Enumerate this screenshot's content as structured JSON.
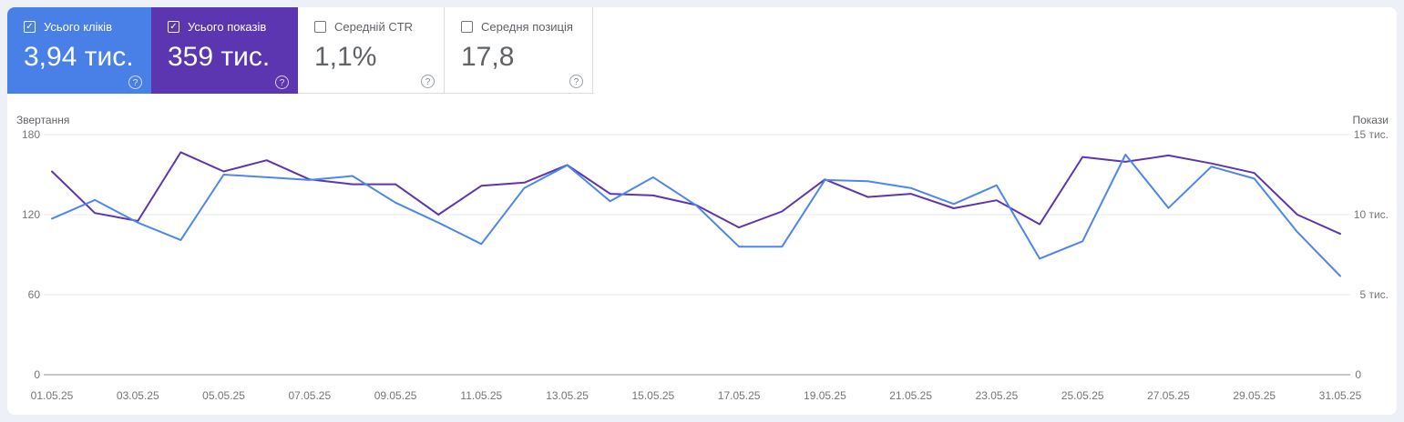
{
  "cards": [
    {
      "label": "Усього кліків",
      "value": "3,94 тис.",
      "checked": true,
      "bg": "#4880e8"
    },
    {
      "label": "Усього показів",
      "value": "359 тис.",
      "checked": true,
      "bg": "#5c35b0"
    },
    {
      "label": "Середній CTR",
      "value": "1,1%",
      "checked": false,
      "bg": "#ffffff"
    },
    {
      "label": "Середня позиція",
      "value": "17,8",
      "checked": false,
      "bg": "#ffffff"
    }
  ],
  "help_icon_glyph": "?",
  "checkmark_glyph": "✓",
  "colors": {
    "clicks_line": "#4e86ec",
    "impressions_line": "#5e35b1",
    "grid": "#e6e8eb",
    "baseline": "#8a9097",
    "axis_text": "#757575",
    "axis_title_text": "#5f6368",
    "page_bg": "#edf0f6",
    "card_border": "#dadce0"
  },
  "chart_data": {
    "type": "line",
    "title": "",
    "left_axis": {
      "title": "Звертання",
      "ticks": [
        0,
        60,
        120,
        180
      ],
      "range": [
        0,
        180
      ]
    },
    "right_axis": {
      "title": "Покази",
      "tick_labels": [
        "0",
        "5 тис.",
        "10 тис.",
        "15 тис."
      ],
      "range_thousands": [
        0,
        15
      ]
    },
    "x_tick_labels": [
      "01.05.25",
      "03.05.25",
      "05.05.25",
      "07.05.25",
      "09.05.25",
      "11.05.25",
      "13.05.25",
      "15.05.25",
      "17.05.25",
      "19.05.25",
      "21.05.25",
      "23.05.25",
      "25.05.25",
      "27.05.25",
      "29.05.25",
      "31.05.25"
    ],
    "dates": [
      "01.05.25",
      "02.05.25",
      "03.05.25",
      "04.05.25",
      "05.05.25",
      "06.05.25",
      "07.05.25",
      "08.05.25",
      "09.05.25",
      "10.05.25",
      "11.05.25",
      "12.05.25",
      "13.05.25",
      "14.05.25",
      "15.05.25",
      "16.05.25",
      "17.05.25",
      "18.05.25",
      "19.05.25",
      "20.05.25",
      "21.05.25",
      "22.05.25",
      "23.05.25",
      "24.05.25",
      "25.05.25",
      "26.05.25",
      "27.05.25",
      "28.05.25",
      "29.05.25",
      "30.05.25",
      "31.05.25"
    ],
    "grid": "horizontal",
    "legend_position": "none",
    "series": [
      {
        "name": "Усього кліків",
        "axis": "left",
        "color": "#4e86ec",
        "values": [
          117,
          131,
          114,
          101,
          150,
          148,
          146,
          149,
          129,
          114,
          98,
          140,
          157,
          130,
          148,
          127,
          96,
          96,
          146,
          145,
          140,
          128,
          142,
          87,
          100,
          165,
          125,
          156,
          147,
          107,
          74
        ]
      },
      {
        "name": "Усього показів",
        "axis": "right",
        "unit": "тис.",
        "color": "#5e35b1",
        "values_thousands": [
          12.7,
          10.1,
          9.6,
          13.9,
          12.7,
          13.4,
          12.2,
          11.9,
          11.9,
          10.0,
          11.8,
          12.0,
          13.1,
          11.3,
          11.2,
          10.6,
          9.2,
          10.2,
          12.2,
          11.1,
          11.3,
          10.4,
          10.9,
          9.4,
          13.6,
          13.3,
          13.7,
          13.2,
          12.6,
          10.0,
          8.8
        ]
      }
    ]
  }
}
